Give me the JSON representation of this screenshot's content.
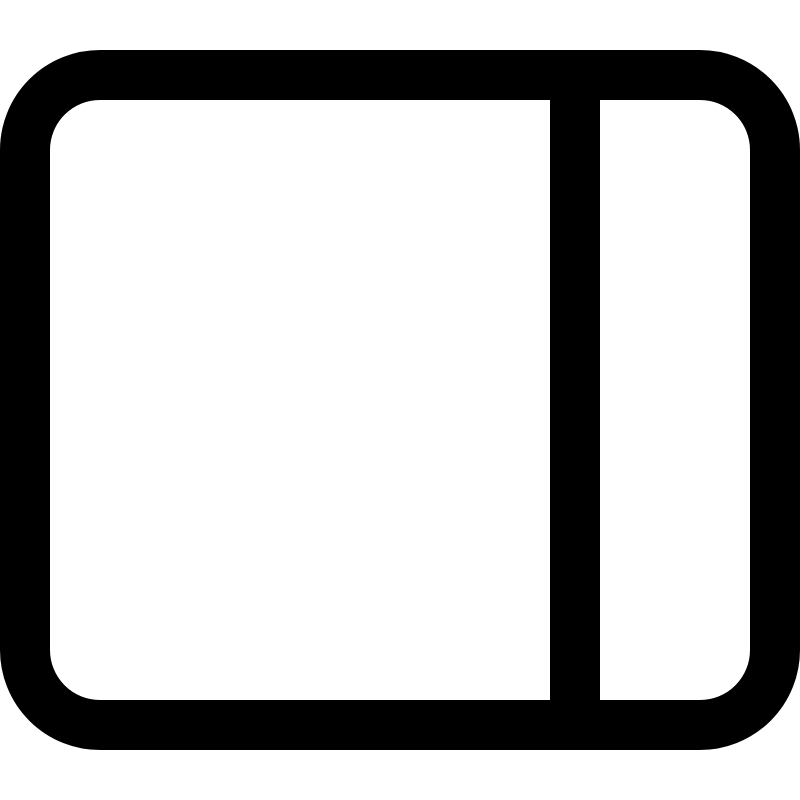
{
  "icon": {
    "name": "sidebar-right-icon",
    "colors": {
      "stroke": "#000000",
      "background": "#ffffff"
    }
  }
}
